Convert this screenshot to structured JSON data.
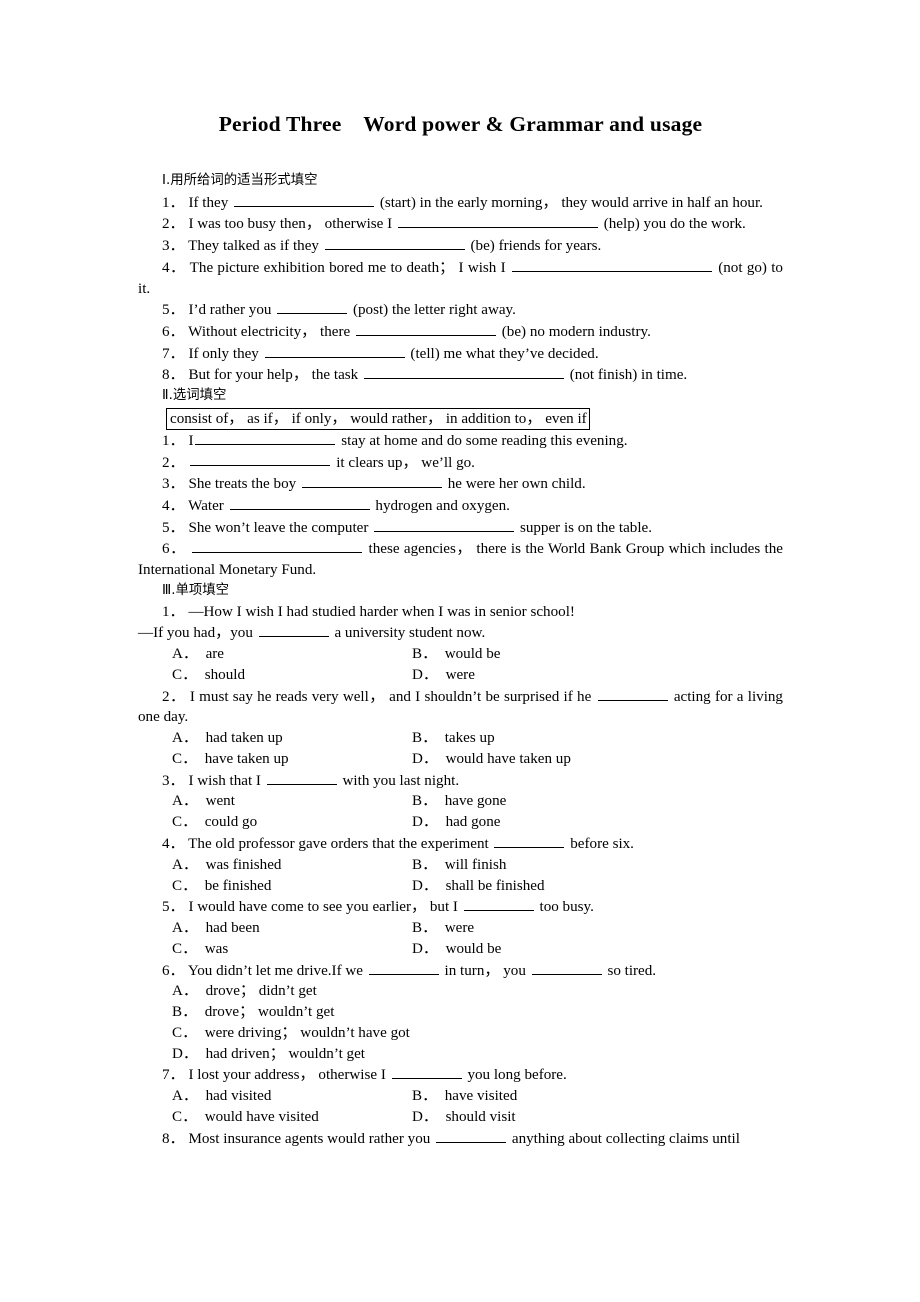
{
  "document": {
    "title": "Period Three Word power & Grammar and usage"
  },
  "section1": {
    "heading": "Ⅰ.用所给词的适当形式填空",
    "items": [
      {
        "number": "1．",
        "before": "If they",
        "after": "(start) in the early morning， they would arrive in half an hour."
      },
      {
        "number": "2．",
        "before": "I was too busy then， otherwise I",
        "after": "(help) you do the work."
      },
      {
        "number": "3．",
        "before": "They talked as if they",
        "after": "(be) friends for years."
      },
      {
        "number": "4．",
        "before": "The picture exhibition bored me to death； I wish I",
        "after": "(not go) to it."
      },
      {
        "number": "5．",
        "before": "I’d rather you",
        "after": "(post) the letter right away."
      },
      {
        "number": "6．",
        "before": "Without electricity， there",
        "after": "(be) no modern industry."
      },
      {
        "number": "7．",
        "before": "If only they",
        "after": "(tell) me what they’ve decided."
      },
      {
        "number": "8．",
        "before": "But for your help， the task",
        "after": "(not finish) in time."
      }
    ]
  },
  "section2": {
    "heading": "Ⅱ.选词填空",
    "wordbank": "consist of， as if， if only， would rather， in addition to， even if",
    "items": [
      {
        "number": "1．",
        "before": "I",
        "after": "stay at home and do some reading this evening."
      },
      {
        "number": "2．",
        "before": "",
        "after": "it clears up， we’ll go."
      },
      {
        "number": "3．",
        "before": "She treats the boy",
        "after": "he were her own child."
      },
      {
        "number": "4．",
        "before": "Water",
        "after": "hydrogen and oxygen."
      },
      {
        "number": "5．",
        "before": "She won’t leave the computer",
        "after": "supper is on the table."
      },
      {
        "number": "6．",
        "before": "",
        "after": "these agencies， there is the World Bank Group which includes the International Monetary Fund."
      }
    ]
  },
  "section3": {
    "heading": "Ⅲ.单项填空",
    "items": [
      {
        "number": "1．",
        "stem_line1": "—How I wish I had studied harder when I was in senior school!",
        "stem_line2_before": "—If you had，you",
        "stem_line2_after": "a university student now.",
        "options": [
          {
            "label": "A．",
            "text": "are"
          },
          {
            "label": "B．",
            "text": "would be"
          },
          {
            "label": "C．",
            "text": "should"
          },
          {
            "label": "D．",
            "text": "were"
          }
        ]
      },
      {
        "number": "2．",
        "stem_before": "I must say he reads very well， and I shouldn’t be surprised if he",
        "stem_after": "acting for a living one day.",
        "options": [
          {
            "label": "A．",
            "text": "had taken up"
          },
          {
            "label": "B．",
            "text": "takes up"
          },
          {
            "label": "C．",
            "text": "have taken up"
          },
          {
            "label": "D．",
            "text": "would have taken up"
          }
        ]
      },
      {
        "number": "3．",
        "stem_before": "I wish that I",
        "stem_after": "with you last night.",
        "options": [
          {
            "label": "A．",
            "text": "went"
          },
          {
            "label": "B．",
            "text": "have gone"
          },
          {
            "label": "C．",
            "text": "could go"
          },
          {
            "label": "D．",
            "text": "had gone"
          }
        ]
      },
      {
        "number": "4．",
        "stem_before": "The old professor gave orders that the experiment",
        "stem_after": "before six.",
        "options": [
          {
            "label": "A．",
            "text": "was finished"
          },
          {
            "label": "B．",
            "text": "will finish"
          },
          {
            "label": "C．",
            "text": "be finished"
          },
          {
            "label": "D．",
            "text": "shall be finished"
          }
        ]
      },
      {
        "number": "5．",
        "stem_before": "I would have come to see you earlier， but I",
        "stem_after": "too busy.",
        "options": [
          {
            "label": "A．",
            "text": "had been"
          },
          {
            "label": "B．",
            "text": "were"
          },
          {
            "label": "C．",
            "text": "was"
          },
          {
            "label": "D．",
            "text": "would be"
          }
        ]
      },
      {
        "number": "6．",
        "stem_before": "You didn’t let me drive.If we",
        "stem_mid": "in turn， you",
        "stem_after": "so tired.",
        "options": [
          {
            "label": "A．",
            "text": "drove； didn’t get"
          },
          {
            "label": "B．",
            "text": "drove； wouldn’t get"
          },
          {
            "label": "C．",
            "text": "were driving； wouldn’t have got"
          },
          {
            "label": "D．",
            "text": "had driven； wouldn’t get"
          }
        ]
      },
      {
        "number": "7．",
        "stem_before": "I lost your address， otherwise I",
        "stem_after": "you long before.",
        "options": [
          {
            "label": "A．",
            "text": "had visited"
          },
          {
            "label": "B．",
            "text": "have visited"
          },
          {
            "label": "C．",
            "text": "would have visited"
          },
          {
            "label": "D．",
            "text": "should visit"
          }
        ]
      },
      {
        "number": "8．",
        "stem_before": "Most insurance agents would rather you",
        "stem_after": "anything about collecting claims until"
      }
    ]
  }
}
